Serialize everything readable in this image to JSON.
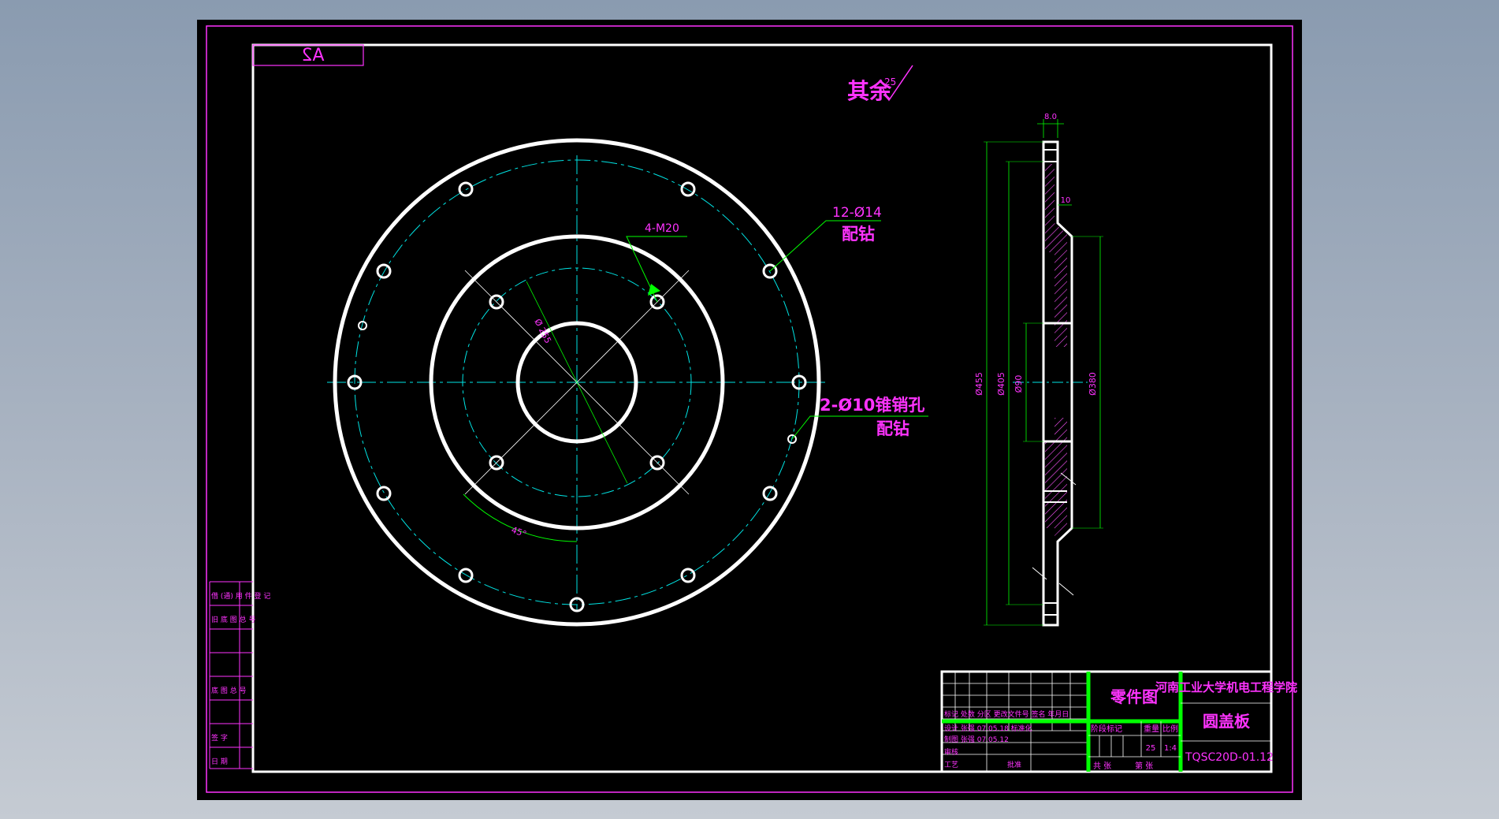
{
  "sheet": {
    "size_mark": "A2",
    "roughness": {
      "label": "其余",
      "value": "25"
    }
  },
  "front_view": {
    "callouts": {
      "bolt_holes_outer": "12-Ø14",
      "bolt_holes_outer_note": "配钻",
      "threaded_holes": "4-M20",
      "pin_holes": "2-Ø10锥销孔",
      "pin_holes_note": "配钻",
      "pitch_circle": "Ø 255",
      "angle": "45°"
    }
  },
  "section_view": {
    "dims": {
      "thickness": "8.0",
      "step": "10",
      "d1": "Ø455",
      "d2": "Ø405",
      "d3": "Ø90",
      "d4": "Ø380"
    }
  },
  "title_block": {
    "school": "河南工业大学机电工程学院",
    "drawing_kind": "零件图",
    "part_name": "圆盖板",
    "drawing_number": "TQSC20D-01.12",
    "header_row": "标记 处数 分区 更改文件号 签名 年月日",
    "designer_row": "设计 张强 07.05.18 标准化",
    "drafter_row": "制图 张强 07.05.12",
    "review_label": "审核",
    "process_label": "工艺",
    "approve_label": "批准",
    "stage_label": "阶段标记",
    "weight_label": "重量",
    "scale_label": "比例",
    "weight_value": "25",
    "scale_value": "1:4",
    "sheet_total_label": "共 张",
    "sheet_index_label": "第 张"
  },
  "side_labels": [
    "借 (通) 用 件 登 记",
    "旧 底 图 总 号",
    "底 图 总 号",
    "签 字",
    "日 期"
  ]
}
